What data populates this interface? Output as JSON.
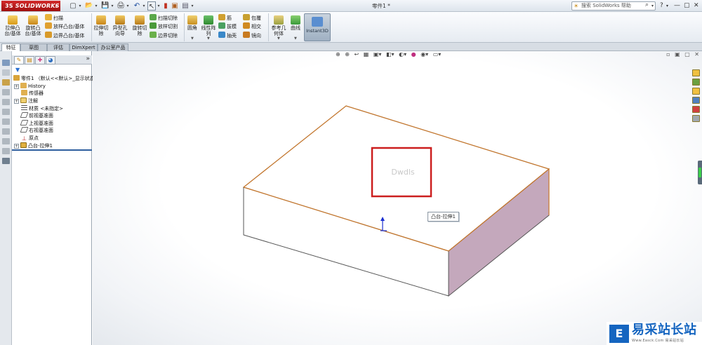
{
  "app": {
    "logo_text": "SOLIDWORKS",
    "logo_mark": "3S",
    "document_title": "零件1 *",
    "search_placeholder": "搜索 SolidWorks 帮助",
    "help_label": "?",
    "window_controls": [
      "—",
      "▢",
      "✕"
    ]
  },
  "quick_access": [
    "▢",
    "▾",
    "📂",
    "▾",
    "💾",
    "▾",
    "🖨",
    "▾",
    "↶",
    "▾",
    "↖",
    "▾",
    "▮",
    "▣",
    "▤",
    "▾"
  ],
  "ribbon": {
    "large_buttons": [
      {
        "label": "拉伸凸\n台/基体",
        "icon": "extrude-boss-icon"
      },
      {
        "label": "旋转凸\n台/基体",
        "icon": "revolve-boss-icon"
      },
      {
        "label": "拉伸切\n除",
        "icon": "extrude-cut-icon"
      },
      {
        "label": "异型孔\n向导",
        "icon": "hole-wizard-icon"
      },
      {
        "label": "旋转切\n除",
        "icon": "revolve-cut-icon"
      },
      {
        "label": "圆角",
        "icon": "fillet-icon"
      },
      {
        "label": "线性阵\n列",
        "icon": "linear-pattern-icon"
      },
      {
        "label": "参考几\n何体",
        "icon": "reference-geometry-icon"
      },
      {
        "label": "曲线",
        "icon": "curves-icon"
      }
    ],
    "small_col1": [
      "扫描",
      "放样凸台/基体",
      "边界凸台/基体"
    ],
    "small_col2": [
      "扫描切除",
      "放样切割",
      "边界切除"
    ],
    "small_col3": [
      "筋",
      "拔模",
      "抽壳"
    ],
    "small_col4": [
      "包覆",
      "相交",
      "镜向"
    ],
    "instant3d_label": "Instant3D"
  },
  "tabs": [
    "特征",
    "草图",
    "评估",
    "DimXpert",
    "办公室产品"
  ],
  "active_tab": 0,
  "feature_tree": {
    "root": "零件1 （默认<<默认>_显示状态",
    "items": [
      {
        "label": "History",
        "expand": "+"
      },
      {
        "label": "传感器",
        "expand": ""
      },
      {
        "label": "注解",
        "expand": "+"
      },
      {
        "label": "材质 <未指定>",
        "expand": ""
      },
      {
        "label": "前视基准面",
        "expand": ""
      },
      {
        "label": "上视基准面",
        "expand": ""
      },
      {
        "label": "右视基准面",
        "expand": ""
      },
      {
        "label": "原点",
        "expand": ""
      },
      {
        "label": "凸台-拉伸1",
        "expand": "+"
      }
    ],
    "more": "»"
  },
  "graphics": {
    "callout_label": "凸台-拉伸1",
    "face_text": "Dwdls",
    "hud_icons": [
      "zoom-fit",
      "zoom-area",
      "previous-view",
      "section-view",
      "view-orientation",
      "display-style",
      "hide-show",
      "edit-appearance",
      "apply-scene",
      "view-settings"
    ],
    "colors": {
      "edge": "#c8772a",
      "top_face": "#ffffff",
      "front_face": "#ffffff",
      "side_face": "#c4a8bc",
      "highlight_box": "#cc1f1f",
      "origin_arrow": "#1a2fd0"
    }
  },
  "watermark": {
    "logo": "E",
    "title": "易采站长站",
    "url": "Www.Easck.Com  易采站长站"
  }
}
